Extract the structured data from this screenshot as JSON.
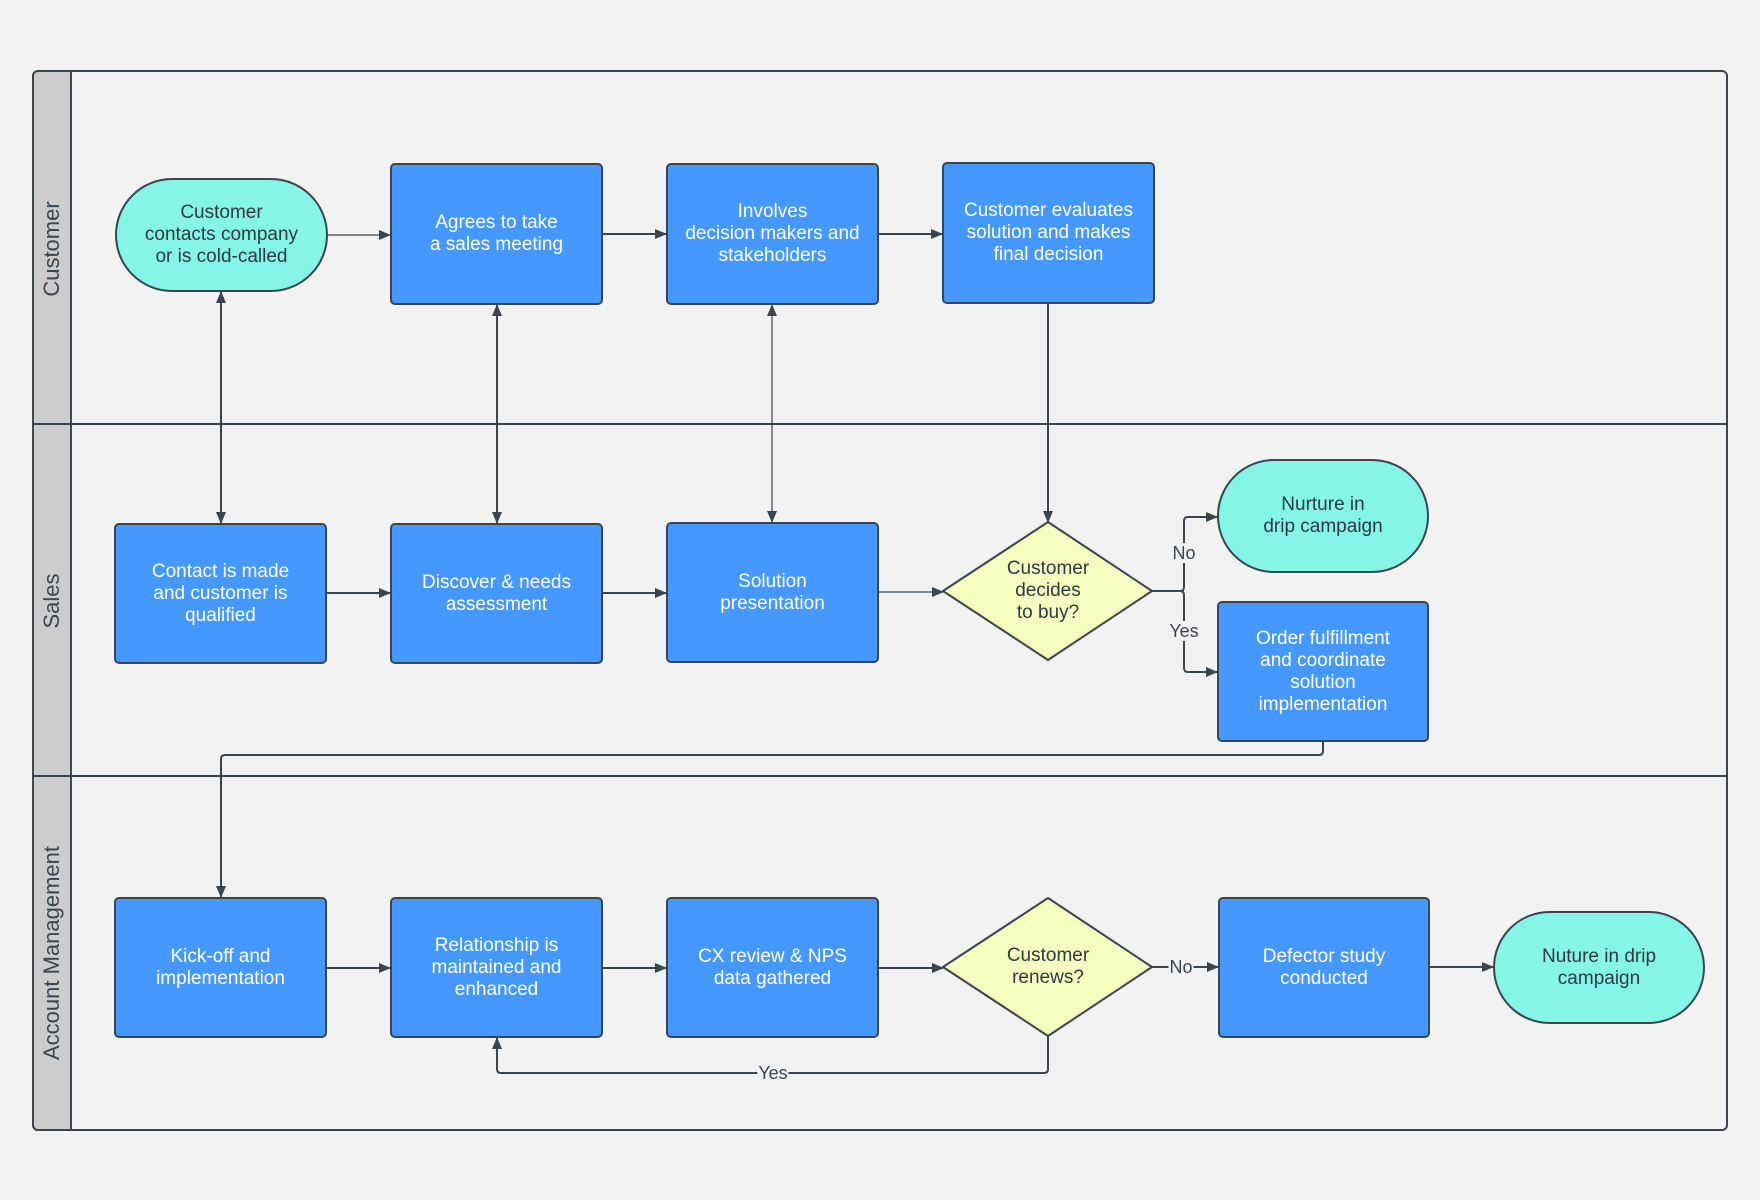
{
  "colors": {
    "background": "#f2f2f2",
    "lane_header": "#cccccc",
    "stroke": "#3b4550",
    "process_fill": "#4598ff",
    "terminal_fill": "#84f5e6",
    "decision_fill": "#f5fdbf"
  },
  "lanes": [
    {
      "id": "customer",
      "label": "Customer"
    },
    {
      "id": "sales",
      "label": "Sales"
    },
    {
      "id": "account",
      "label": "Account Management"
    }
  ],
  "nodes": {
    "customer_contacts": {
      "type": "terminal",
      "lane": "Customer",
      "label": "Customer\ncontacts company\nor is cold-called"
    },
    "agrees_meeting": {
      "type": "process",
      "lane": "Customer",
      "label": "Agrees to take\na sales meeting"
    },
    "involves_decision": {
      "type": "process",
      "lane": "Customer",
      "label": "Involves\ndecision makers and\nstakeholders"
    },
    "customer_evaluates": {
      "type": "process",
      "lane": "Customer",
      "label": "Customer evaluates\nsolution and makes\nfinal decision"
    },
    "contact_made": {
      "type": "process",
      "lane": "Sales",
      "label": "Contact is made\nand customer is\nqualified"
    },
    "discover_needs": {
      "type": "process",
      "lane": "Sales",
      "label": "Discover & needs\nassessment"
    },
    "solution_presentation": {
      "type": "process",
      "lane": "Sales",
      "label": "Solution\npresentation"
    },
    "decides_buy": {
      "type": "decision",
      "lane": "Sales",
      "label": "Customer\ndecides\nto buy?"
    },
    "nurture_drip_1": {
      "type": "terminal",
      "lane": "Sales",
      "label": "Nurture in\ndrip campaign"
    },
    "order_fulfillment": {
      "type": "process",
      "lane": "Sales",
      "label": "Order fulfillment\nand coordinate\nsolution\nimplementation"
    },
    "kickoff": {
      "type": "process",
      "lane": "Account Management",
      "label": "Kick-off and\nimplementation"
    },
    "relationship": {
      "type": "process",
      "lane": "Account Management",
      "label": "Relationship is\nmaintained and\nenhanced"
    },
    "cx_review": {
      "type": "process",
      "lane": "Account Management",
      "label": "CX review & NPS\ndata gathered"
    },
    "renews": {
      "type": "decision",
      "lane": "Account Management",
      "label": "Customer\nrenews?"
    },
    "defector_study": {
      "type": "process",
      "lane": "Account Management",
      "label": "Defector study\nconducted"
    },
    "nurture_drip_2": {
      "type": "terminal",
      "lane": "Account Management",
      "label": "Nuture in drip\ncampaign"
    }
  },
  "edges": [
    {
      "from": "customer_contacts",
      "to": "agrees_meeting",
      "label": ""
    },
    {
      "from": "agrees_meeting",
      "to": "involves_decision",
      "label": ""
    },
    {
      "from": "involves_decision",
      "to": "customer_evaluates",
      "label": ""
    },
    {
      "from": "customer_contacts",
      "to": "contact_made",
      "label": "",
      "bidirectional": true
    },
    {
      "from": "agrees_meeting",
      "to": "discover_needs",
      "label": "",
      "bidirectional": true
    },
    {
      "from": "involves_decision",
      "to": "solution_presentation",
      "label": "",
      "bidirectional": true
    },
    {
      "from": "customer_evaluates",
      "to": "decides_buy",
      "label": ""
    },
    {
      "from": "contact_made",
      "to": "discover_needs",
      "label": ""
    },
    {
      "from": "discover_needs",
      "to": "solution_presentation",
      "label": ""
    },
    {
      "from": "solution_presentation",
      "to": "decides_buy",
      "label": ""
    },
    {
      "from": "decides_buy",
      "to": "nurture_drip_1",
      "label": "No"
    },
    {
      "from": "decides_buy",
      "to": "order_fulfillment",
      "label": "Yes"
    },
    {
      "from": "order_fulfillment",
      "to": "kickoff",
      "label": ""
    },
    {
      "from": "kickoff",
      "to": "relationship",
      "label": ""
    },
    {
      "from": "relationship",
      "to": "cx_review",
      "label": ""
    },
    {
      "from": "cx_review",
      "to": "renews",
      "label": ""
    },
    {
      "from": "renews",
      "to": "defector_study",
      "label": "No"
    },
    {
      "from": "renews",
      "to": "relationship",
      "label": "Yes"
    },
    {
      "from": "defector_study",
      "to": "nurture_drip_2",
      "label": ""
    }
  ],
  "edge_labels": {
    "buy_no": "No",
    "buy_yes": "Yes",
    "renew_no": "No",
    "renew_yes": "Yes"
  }
}
